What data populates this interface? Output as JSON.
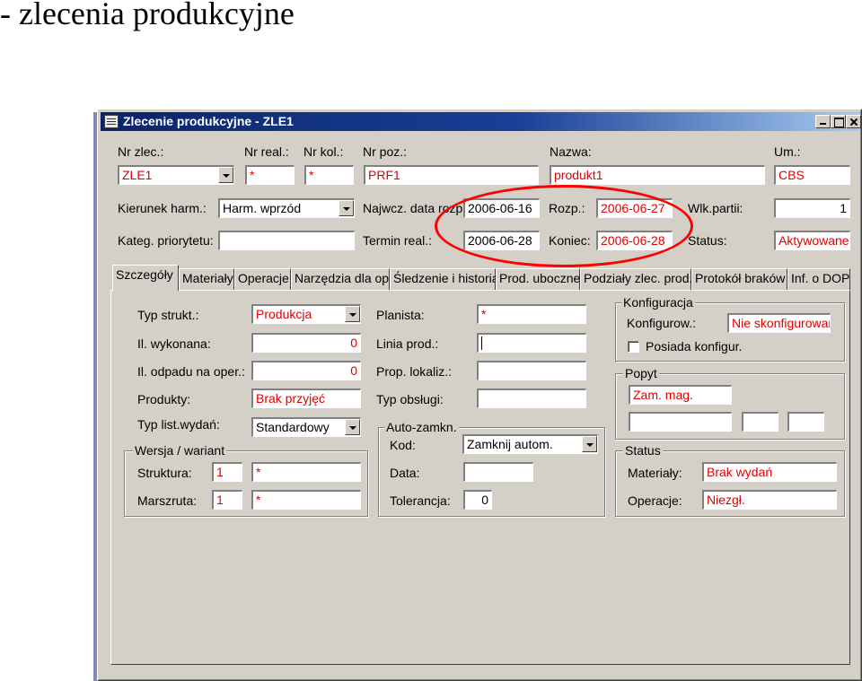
{
  "slide": {
    "title": "- zlecenia produkcyjne"
  },
  "window": {
    "title": "Zlecenie produkcyjne - ZLE1"
  },
  "header": {
    "nr_zlec": {
      "label": "Nr zlec.:",
      "value": "ZLE1"
    },
    "nr_real": {
      "label": "Nr real.:",
      "value": "*"
    },
    "nr_kol": {
      "label": "Nr kol.:",
      "value": "*"
    },
    "nr_poz": {
      "label": "Nr poz.:",
      "value": "PRF1"
    },
    "nazwa": {
      "label": "Nazwa:",
      "value": "produkt1"
    },
    "um": {
      "label": "Um.:",
      "value": "CBS"
    },
    "kierunek": {
      "label": "Kierunek harm.:",
      "value": "Harm. wprzód"
    },
    "najwcz": {
      "label": "Najwcz. data rozp.:",
      "value": "2006-06-16"
    },
    "rozp": {
      "label": "Rozp.:",
      "value": "2006-06-27"
    },
    "wlk_partii": {
      "label": "Wlk.partii:",
      "value": "1"
    },
    "kateg": {
      "label": "Kateg. priorytetu:",
      "value": ""
    },
    "termin": {
      "label": "Termin real.:",
      "value": "2006-06-28"
    },
    "koniec": {
      "label": "Koniec:",
      "value": "2006-06-28"
    },
    "status": {
      "label": "Status:",
      "value": "Aktywowane"
    }
  },
  "tabs": [
    "Szczegóły",
    "Materiały",
    "Operacje",
    "Narzędzia dla op.",
    "Śledzenie i historia",
    "Prod. uboczne",
    "Podziały zlec. prod.",
    "Protokół braków",
    "Inf. o DOP"
  ],
  "details": {
    "typ_strukt": {
      "label": "Typ strukt.:",
      "value": "Produkcja"
    },
    "il_wykonana": {
      "label": "Il. wykonana:",
      "value": "0"
    },
    "il_odpadu": {
      "label": "Il. odpadu na oper.:",
      "value": "0"
    },
    "produkty": {
      "label": "Produkty:",
      "value": "Brak przyjęć"
    },
    "typ_list": {
      "label": "Typ list.wydań:",
      "value": "Standardowy"
    },
    "planista": {
      "label": "Planista:",
      "value": "*"
    },
    "linia_prod": {
      "label": "Linia prod.:",
      "value": ""
    },
    "prop_lokaliz": {
      "label": "Prop. lokaliz.:",
      "value": ""
    },
    "typ_obslugi": {
      "label": "Typ obsługi:",
      "value": ""
    }
  },
  "wersja": {
    "title": "Wersja / wariant",
    "struktura": {
      "label": "Struktura:",
      "num": "1",
      "value": "*"
    },
    "marszruta": {
      "label": "Marszruta:",
      "num": "1",
      "value": "*"
    }
  },
  "auto": {
    "title": "Auto-zamkn.",
    "kod": {
      "label": "Kod:",
      "value": "Zamknij autom."
    },
    "data": {
      "label": "Data:",
      "value": ""
    },
    "tolerancja": {
      "label": "Tolerancja:",
      "value": "0"
    }
  },
  "konfiguracja": {
    "title": "Konfiguracja",
    "konfigurow": {
      "label": "Konfigurow.:",
      "value": "Nie skonfigurowan"
    },
    "posiada": {
      "label": "Posiada konfigur."
    }
  },
  "popyt": {
    "title": "Popyt",
    "value1": "Zam. mag.",
    "value2": "",
    "value3": "",
    "value4": ""
  },
  "status_group": {
    "title": "Status",
    "materialy": {
      "label": "Materiały:",
      "value": "Brak wydań"
    },
    "operacje": {
      "label": "Operacje:",
      "value": "Niezgł."
    }
  },
  "colors": {
    "window_bg": "#d4d0c8",
    "title_bar": "#0a246a",
    "value_red": "#e00000",
    "highlight_oval": "#ff0000"
  }
}
